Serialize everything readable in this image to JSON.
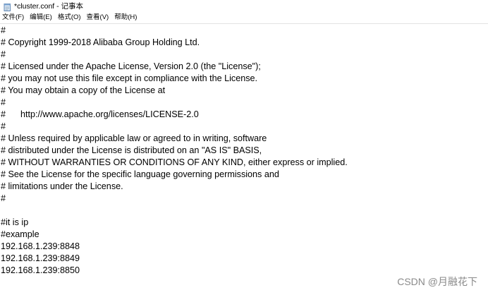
{
  "window": {
    "title": "*cluster.conf - 记事本",
    "app_icon": "notepad-icon"
  },
  "menu": [
    {
      "label": "文件(F)"
    },
    {
      "label": "编辑(E)"
    },
    {
      "label": "格式(O)"
    },
    {
      "label": "查看(V)"
    },
    {
      "label": "帮助(H)"
    }
  ],
  "editor": {
    "lines": [
      "#",
      "# Copyright 1999-2018 Alibaba Group Holding Ltd.",
      "#",
      "# Licensed under the Apache License, Version 2.0 (the \"License\");",
      "# you may not use this file except in compliance with the License.",
      "# You may obtain a copy of the License at",
      "#",
      "#      http://www.apache.org/licenses/LICENSE-2.0",
      "#",
      "# Unless required by applicable law or agreed to in writing, software",
      "# distributed under the License is distributed on an \"AS IS\" BASIS,",
      "# WITHOUT WARRANTIES OR CONDITIONS OF ANY KIND, either express or implied.",
      "# See the License for the specific language governing permissions and",
      "# limitations under the License.",
      "#",
      "",
      "#it is ip",
      "#example",
      "192.168.1.239:8848",
      "192.168.1.239:8849",
      "192.168.1.239:8850"
    ]
  },
  "watermark": {
    "text": "CSDN @月融花下"
  }
}
